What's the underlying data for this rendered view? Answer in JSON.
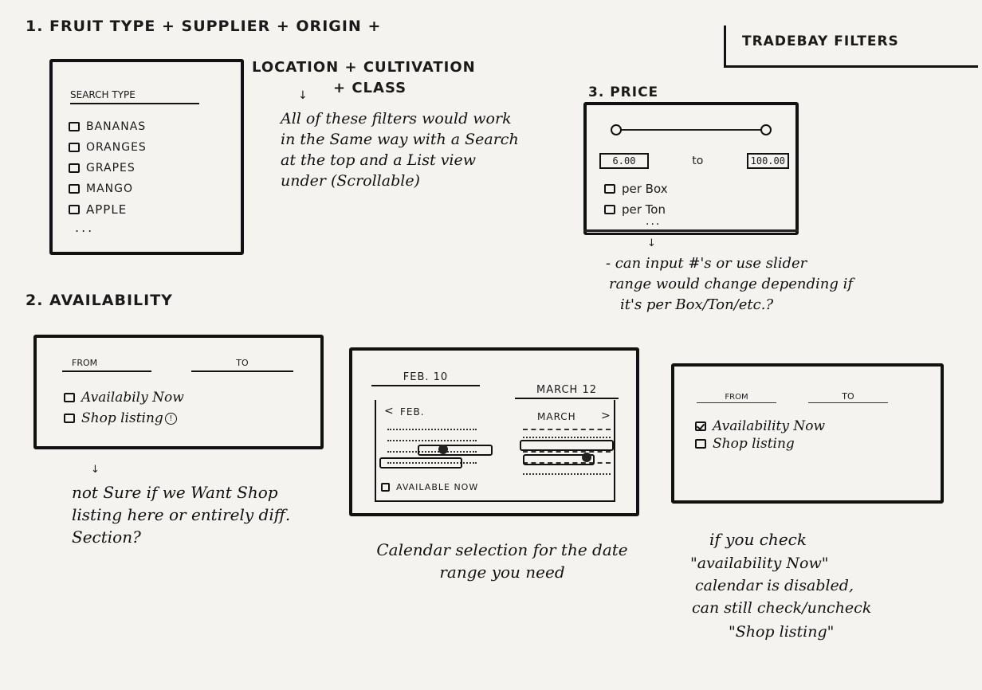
{
  "header": {
    "title_line1": "1. FRUIT TYPE  + SUPPLIER + ORIGIN +",
    "title_line2": "LOCATION + CULTIVATION",
    "title_line3": "+ CLASS",
    "page_tag": "TRADEBAY FILTERS"
  },
  "fruit": {
    "search_label": "SEARCH TYPE",
    "items": [
      {
        "label": "BANANAS"
      },
      {
        "label": "ORANGES"
      },
      {
        "label": "GRAPES"
      },
      {
        "label": "MANGO"
      },
      {
        "label": "APPLE"
      }
    ],
    "more": "...",
    "note": "All of these filters would work in the Same way with a Search at the top and a List view under (Scrollable)"
  },
  "price": {
    "heading": "3. PRICE",
    "min_value": "6.00",
    "to_label": "to",
    "max_value": "100.00",
    "options": [
      {
        "label": "per Box"
      },
      {
        "label": "per Ton"
      }
    ],
    "more": "...",
    "note_line1": "- can input #'s or use slider",
    "note_line2": "range would change depending if",
    "note_line3": "it's per Box/Ton/etc.?"
  },
  "availability": {
    "heading": "2. AVAILABILITY",
    "from_label": "FROM",
    "to_label": "TO",
    "option_now": "Availabily Now",
    "option_shop": "Shop listing",
    "info_icon": "info-circle-icon",
    "note": "not Sure if we Want Shop listing here or entirely diff. Section?"
  },
  "calendar": {
    "from_date": "FEB. 10",
    "to_date": "MARCH 12",
    "left_month": "FEB.",
    "right_month": "MARCH",
    "available_now": "AVAILABLE NOW",
    "note": "Calendar selection for the date range you need"
  },
  "availability_checked": {
    "from_label": "FROM",
    "to_label": "TO",
    "option_now": "Availability Now",
    "option_shop": "Shop listing",
    "now_checked": true,
    "note_line1": "if you check",
    "note_line2": "\"availability Now\"",
    "note_line3": "calendar is disabled,",
    "note_line4": "can still check/uncheck",
    "note_line5": "\"Shop listing\""
  }
}
